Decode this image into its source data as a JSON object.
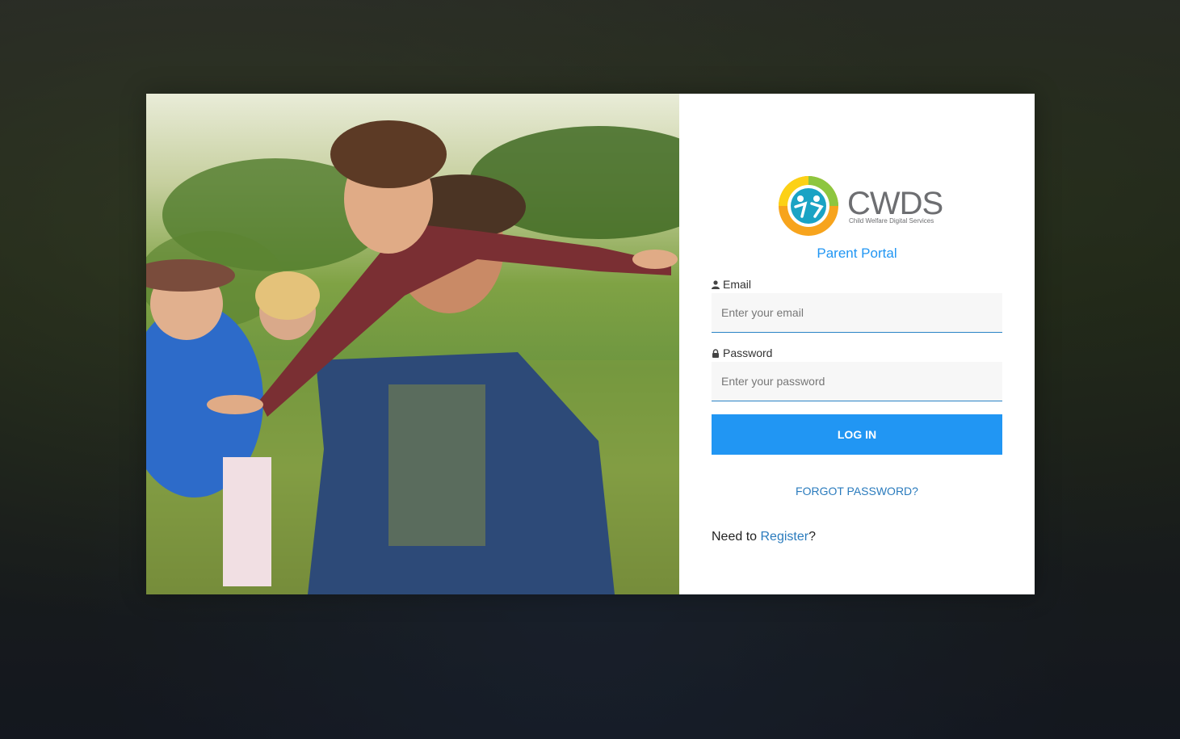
{
  "logo": {
    "name": "CWDS",
    "tagline": "Child Welfare Digital Services"
  },
  "portal_title": "Parent Portal",
  "email": {
    "label": "Email",
    "placeholder": "Enter your email",
    "icon": "user-icon"
  },
  "password": {
    "label": "Password",
    "placeholder": "Enter your password",
    "icon": "lock-icon"
  },
  "login_button": "LOG IN",
  "forgot_password": "FORGOT PASSWORD?",
  "register": {
    "prefix": "Need to ",
    "link": "Register",
    "suffix": "?"
  },
  "colors": {
    "accent": "#2196f3",
    "link": "#2a7bbd",
    "input_bg": "#f7f7f7"
  }
}
